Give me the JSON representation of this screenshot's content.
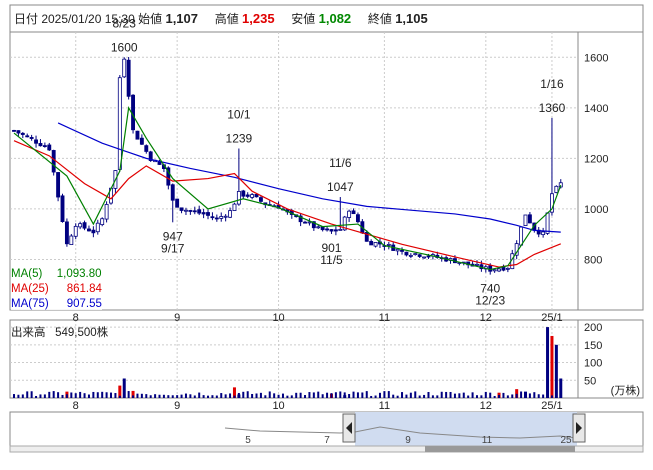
{
  "header": {
    "date": "日付 2025/01/20 15:30",
    "open_label": "始値",
    "open": "1,107",
    "high_label": "高値",
    "high": "1,235",
    "low_label": "安値",
    "low": "1,082",
    "close_label": "終値",
    "close": "1,105"
  },
  "legend": [
    {
      "name": "MA(5)",
      "value": "1,093.80",
      "color": "#008000"
    },
    {
      "name": "MA(25)",
      "value": "861.84",
      "color": "#e00000"
    },
    {
      "name": "MA(75)",
      "value": "907.55",
      "color": "#0000cc"
    }
  ],
  "volume_panel": {
    "title": "出来高",
    "value": "549,500株",
    "unit": "(万株)"
  },
  "navigator": {
    "labels": [
      "5",
      "7",
      "9",
      "11",
      "25"
    ]
  },
  "colors": {
    "up": "#ffffff",
    "down": "#000080",
    "up_volume": "#e00000",
    "down_volume": "#000080",
    "ma5": "#008000",
    "ma25": "#e00000",
    "ma75": "#0000cc",
    "grid": "#cccccc"
  },
  "chart_data": {
    "type": "candlestick",
    "x_ticks": [
      "8",
      "9",
      "10",
      "11",
      "12",
      "25/1"
    ],
    "price_ticks": [
      800,
      1000,
      1200,
      1400,
      1600
    ],
    "volume_ticks": [
      50,
      100,
      150,
      200
    ],
    "price_range": [
      600,
      1700
    ],
    "volume_range": [
      0,
      220
    ],
    "annotations": [
      {
        "date": "8/23",
        "value": 1600
      },
      {
        "date": "9/17",
        "value": 947
      },
      {
        "date": "10/1",
        "value": 1239
      },
      {
        "date": "11/5",
        "value": 901
      },
      {
        "date": "11/6",
        "value": 1047
      },
      {
        "date": "12/23",
        "value": 740
      },
      {
        "date": "1/16",
        "value": 1360
      }
    ],
    "ohlc_anchors": [
      {
        "t": 0,
        "c": 1310
      },
      {
        "t": 8,
        "c": 1240
      },
      {
        "t": 10,
        "c": 1050
      },
      {
        "t": 12,
        "c": 860
      },
      {
        "t": 14,
        "c": 940
      },
      {
        "t": 18,
        "c": 910
      },
      {
        "t": 20,
        "c": 960
      },
      {
        "t": 23,
        "c": 1150
      },
      {
        "t": 24,
        "c": 1520
      },
      {
        "t": 25,
        "c": 1600
      },
      {
        "t": 27,
        "c": 1310
      },
      {
        "t": 31,
        "c": 1200
      },
      {
        "t": 34,
        "c": 1160
      },
      {
        "t": 36,
        "c": 1030
      },
      {
        "t": 38,
        "c": 1000
      },
      {
        "t": 43,
        "c": 980
      },
      {
        "t": 46,
        "c": 960
      },
      {
        "t": 49,
        "c": 990
      },
      {
        "t": 51,
        "c": 1060
      },
      {
        "t": 54,
        "c": 1050
      },
      {
        "t": 57,
        "c": 1020
      },
      {
        "t": 60,
        "c": 1010
      },
      {
        "t": 63,
        "c": 970
      },
      {
        "t": 66,
        "c": 950
      },
      {
        "t": 69,
        "c": 920
      },
      {
        "t": 72,
        "c": 910
      },
      {
        "t": 74,
        "c": 920
      },
      {
        "t": 76,
        "c": 1000
      },
      {
        "t": 78,
        "c": 950
      },
      {
        "t": 80,
        "c": 870
      },
      {
        "t": 84,
        "c": 860
      },
      {
        "t": 88,
        "c": 830
      },
      {
        "t": 94,
        "c": 815
      },
      {
        "t": 100,
        "c": 795
      },
      {
        "t": 104,
        "c": 775
      },
      {
        "t": 108,
        "c": 760
      },
      {
        "t": 112,
        "c": 770
      },
      {
        "t": 114,
        "c": 870
      },
      {
        "t": 116,
        "c": 980
      },
      {
        "t": 118,
        "c": 920
      },
      {
        "t": 120,
        "c": 900
      },
      {
        "t": 122,
        "c": 1060
      },
      {
        "t": 124,
        "c": 1100
      }
    ],
    "ma5": [
      [
        0,
        1300
      ],
      [
        12,
        1130
      ],
      [
        18,
        940
      ],
      [
        24,
        1150
      ],
      [
        26,
        1400
      ],
      [
        30,
        1280
      ],
      [
        36,
        1120
      ],
      [
        44,
        1000
      ],
      [
        52,
        1040
      ],
      [
        60,
        1005
      ],
      [
        70,
        930
      ],
      [
        78,
        940
      ],
      [
        84,
        855
      ],
      [
        96,
        810
      ],
      [
        108,
        760
      ],
      [
        112,
        775
      ],
      [
        118,
        935
      ],
      [
        122,
        1000
      ],
      [
        124,
        1094
      ]
    ],
    "ma25": [
      [
        0,
        1270
      ],
      [
        8,
        1210
      ],
      [
        16,
        1100
      ],
      [
        22,
        1040
      ],
      [
        26,
        1120
      ],
      [
        30,
        1170
      ],
      [
        36,
        1110
      ],
      [
        44,
        1120
      ],
      [
        50,
        1140
      ],
      [
        54,
        1070
      ],
      [
        62,
        1000
      ],
      [
        72,
        940
      ],
      [
        80,
        900
      ],
      [
        88,
        860
      ],
      [
        100,
        810
      ],
      [
        110,
        770
      ],
      [
        114,
        780
      ],
      [
        118,
        820
      ],
      [
        124,
        862
      ]
    ],
    "ma75": [
      [
        10,
        1340
      ],
      [
        20,
        1260
      ],
      [
        30,
        1200
      ],
      [
        40,
        1160
      ],
      [
        50,
        1125
      ],
      [
        60,
        1080
      ],
      [
        70,
        1040
      ],
      [
        80,
        1010
      ],
      [
        90,
        995
      ],
      [
        100,
        980
      ],
      [
        108,
        960
      ],
      [
        114,
        935
      ],
      [
        118,
        915
      ],
      [
        124,
        908
      ]
    ],
    "volume_bars": [
      {
        "t": 12,
        "v": 18,
        "up": true
      },
      {
        "t": 24,
        "v": 35,
        "up": true
      },
      {
        "t": 25,
        "v": 55,
        "up": false
      },
      {
        "t": 27,
        "v": 20,
        "up": true
      },
      {
        "t": 50,
        "v": 30,
        "up": true
      },
      {
        "t": 51,
        "v": 10,
        "up": false
      },
      {
        "t": 72,
        "v": 12,
        "up": true
      },
      {
        "t": 75,
        "v": 8,
        "up": false
      },
      {
        "t": 110,
        "v": 15,
        "up": true
      },
      {
        "t": 114,
        "v": 25,
        "up": true
      },
      {
        "t": 116,
        "v": 18,
        "up": false
      },
      {
        "t": 121,
        "v": 200,
        "up": false
      },
      {
        "t": 122,
        "v": 175,
        "up": true
      },
      {
        "t": 123,
        "v": 150,
        "up": false
      },
      {
        "t": 124,
        "v": 55,
        "up": false
      }
    ]
  }
}
